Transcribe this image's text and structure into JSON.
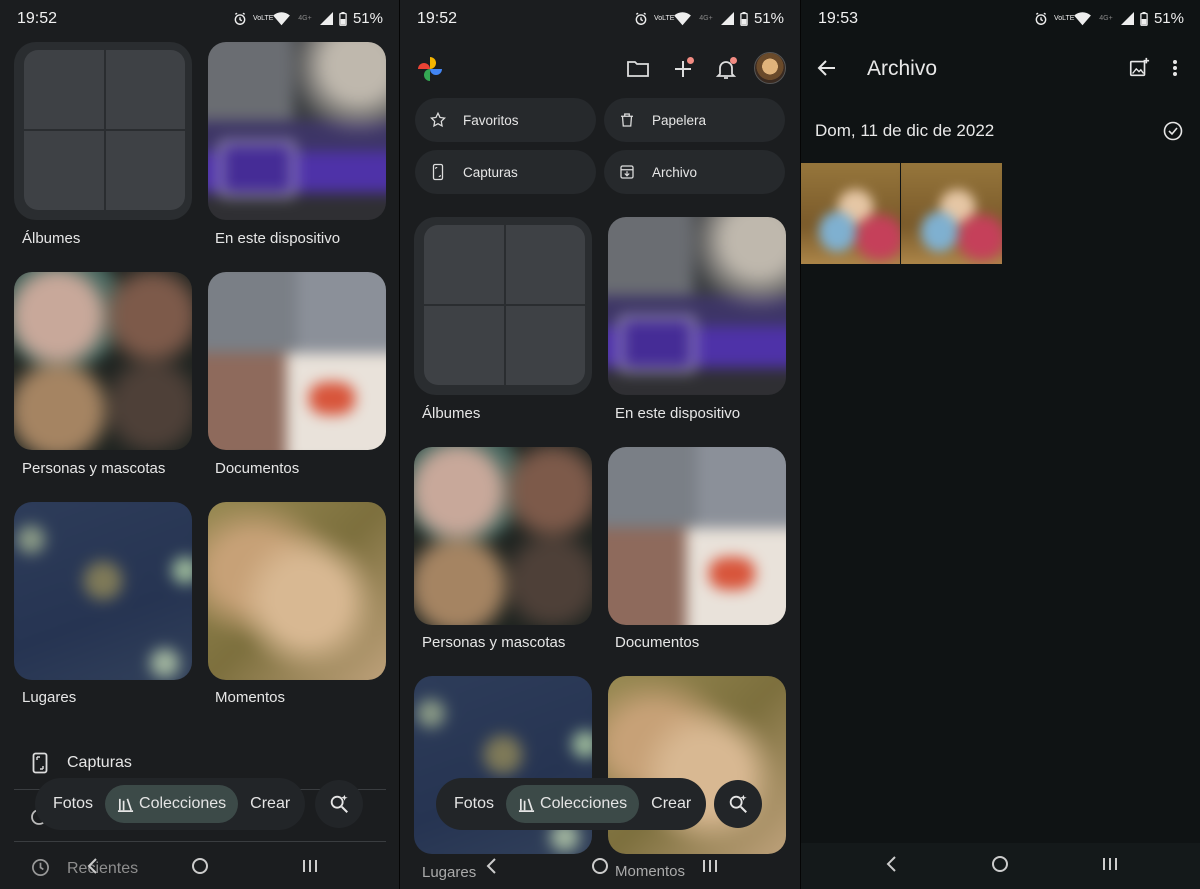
{
  "panel1": {
    "status": {
      "time": "19:52",
      "battery": "51%",
      "volte": "VoLTE",
      "net": "4G+"
    },
    "tiles": [
      {
        "label": "Álbumes"
      },
      {
        "label": "En este dispositivo"
      },
      {
        "label": "Personas y mascotas"
      },
      {
        "label": "Documentos"
      },
      {
        "label": "Lugares"
      },
      {
        "label": "Momentos"
      }
    ],
    "list": {
      "capturas": "Capturas",
      "recientes": "Recientes"
    },
    "nav": {
      "fotos": "Fotos",
      "colecciones": "Colecciones",
      "crear": "Crear"
    }
  },
  "panel2": {
    "status": {
      "time": "19:52",
      "battery": "51%",
      "volte": "VoLTE",
      "net": "4G+"
    },
    "chips": {
      "favoritos": "Favoritos",
      "papelera": "Papelera",
      "capturas": "Capturas",
      "archivo": "Archivo"
    },
    "tiles": [
      {
        "label": "Álbumes"
      },
      {
        "label": "En este dispositivo"
      },
      {
        "label": "Personas y mascotas"
      },
      {
        "label": "Documentos"
      },
      {
        "label": "Lugares"
      },
      {
        "label": "Momentos"
      }
    ],
    "nav": {
      "fotos": "Fotos",
      "colecciones": "Colecciones",
      "crear": "Crear"
    }
  },
  "panel3": {
    "status": {
      "time": "19:53",
      "battery": "51%",
      "volte": "VoLTE",
      "net": "4G+"
    },
    "title": "Archivo",
    "date": "Dom, 11 de dic de 2022"
  },
  "colors": {
    "accent_active": "#3c4a48",
    "surface": "#1b1d1f",
    "chip": "#26292c"
  }
}
